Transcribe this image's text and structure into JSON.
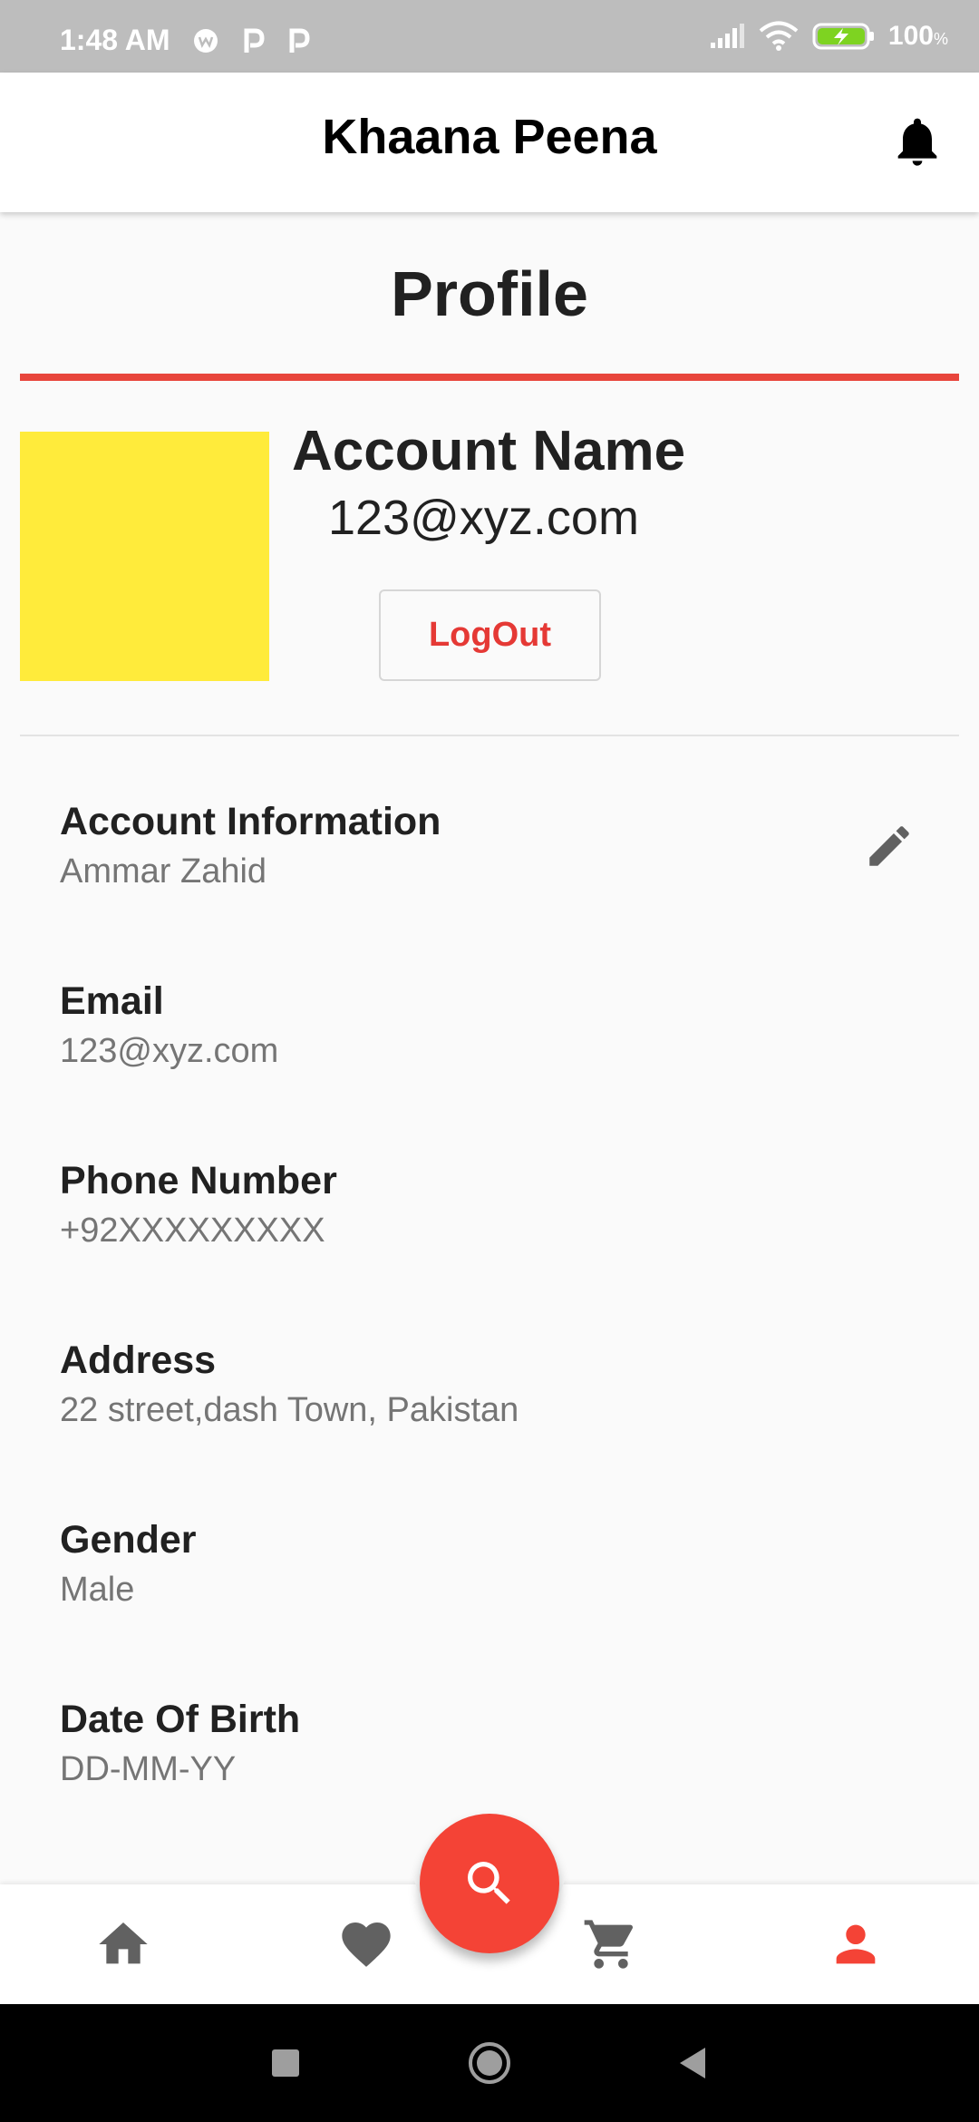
{
  "status_bar": {
    "time": "1:48 AM",
    "battery": "100",
    "battery_unit": "%",
    "icons": [
      "whatsapp-icon",
      "parking-icon",
      "parking-icon",
      "signal-icon",
      "wifi-icon",
      "battery-charging-icon"
    ]
  },
  "app_bar": {
    "title": "Khaana Peena",
    "icon": "bell-icon"
  },
  "profile": {
    "title": "Profile",
    "account_name": "Account Name",
    "email": "123@xyz.com",
    "logout_label": "LogOut"
  },
  "info": [
    {
      "label": "Account Information",
      "value": "Ammar Zahid"
    },
    {
      "label": "Email",
      "value": "123@xyz.com"
    },
    {
      "label": "Phone Number",
      "value": "+92XXXXXXXXX"
    },
    {
      "label": "Address",
      "value": "22 street,dash Town, Pakistan"
    },
    {
      "label": "Gender",
      "value": "Male"
    },
    {
      "label": "Date Of Birth",
      "value": "DD-MM-YY"
    }
  ],
  "bottom_nav": {
    "items": [
      "home-icon",
      "favorite-icon",
      "cart-icon",
      "profile-icon"
    ],
    "active": "profile-icon",
    "fab_icon": "search-icon"
  },
  "colors": {
    "accent": "#f44336",
    "rule": "#e8453c",
    "avatar": "#ffeb3b",
    "inactive_icon": "#616161"
  }
}
